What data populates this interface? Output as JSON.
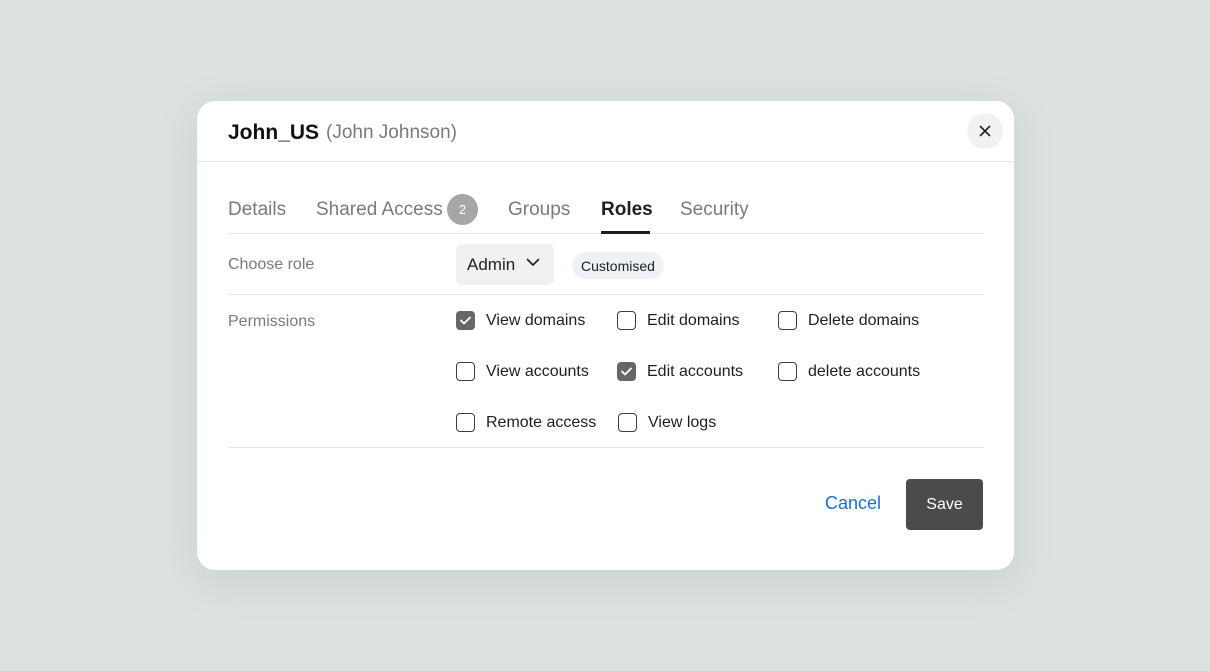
{
  "header": {
    "username": "John_US",
    "fullname": "(John Johnson)",
    "close_icon": "close-icon"
  },
  "tabs": [
    {
      "label": "Details",
      "active": false
    },
    {
      "label": "Shared Access",
      "active": false,
      "badge": "2"
    },
    {
      "label": "Groups",
      "active": false
    },
    {
      "label": "Roles",
      "active": true
    },
    {
      "label": "Security",
      "active": false
    }
  ],
  "role": {
    "label": "Choose role",
    "selected": "Admin",
    "tag": "Customised"
  },
  "permissions": {
    "label": "Permissions",
    "items": [
      {
        "label": "View domains",
        "checked": true
      },
      {
        "label": "Edit domains",
        "checked": false
      },
      {
        "label": "Delete domains",
        "checked": false
      },
      {
        "label": "View accounts",
        "checked": false
      },
      {
        "label": "Edit accounts",
        "checked": true
      },
      {
        "label": "delete accounts",
        "checked": false
      },
      {
        "label": "Remote access",
        "checked": false
      },
      {
        "label": "View logs",
        "checked": false
      }
    ]
  },
  "footer": {
    "cancel_label": "Cancel",
    "save_label": "Save"
  },
  "colors": {
    "background": "#dbe2e1",
    "link": "#1a6fd6",
    "primary_button": "#4b4b4b",
    "checkbox_checked": "#666666"
  }
}
